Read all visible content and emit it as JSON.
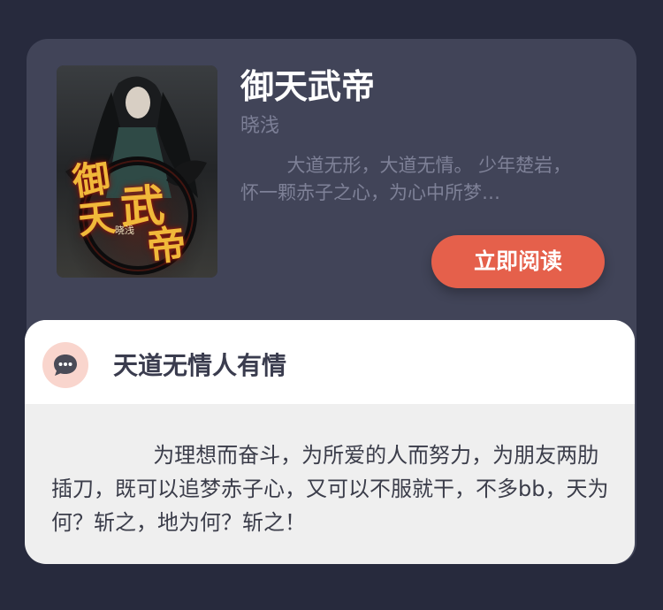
{
  "book": {
    "cover_title_chars": [
      "御",
      "天",
      "武",
      "帝"
    ],
    "cover_author": "晓浅",
    "title": "御天武帝",
    "author": "晓浅",
    "description": "大道无形，大道无情。 少年楚岩，怀一颗赤子之心，为心中所梦…",
    "read_button_label": "立即阅读"
  },
  "review": {
    "icon": "chat-bubble-icon",
    "title": "天道无情人有情",
    "body": "为理想而奋斗，为所爱的人而努力，为朋友两肋插刀，既可以追梦赤子心，又可以不服就干，不多bb，天为何？斩之，地为何？斩之！"
  },
  "colors": {
    "background": "#272a3d",
    "card": "#414458",
    "accent": "#e5604b",
    "icon_bg": "#f9d5cd",
    "review_body_bg": "#efefef"
  }
}
